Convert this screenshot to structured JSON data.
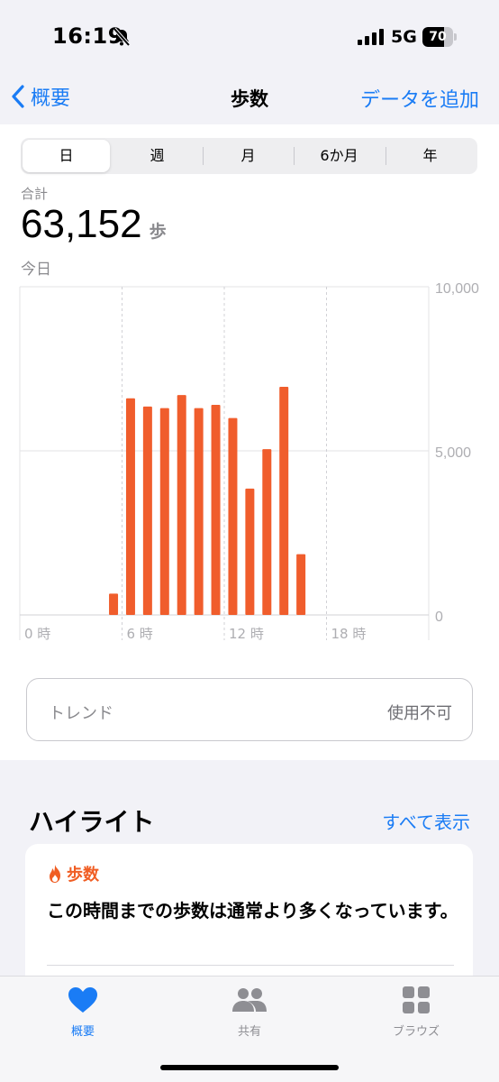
{
  "status_bar": {
    "time": "16:19",
    "network": "5G",
    "battery_level": "70",
    "battery_fraction": 0.7
  },
  "nav": {
    "back_label": "概要",
    "title": "歩数",
    "add_label": "データを追加"
  },
  "segments": [
    {
      "label": "日",
      "selected": true
    },
    {
      "label": "週",
      "selected": false
    },
    {
      "label": "月",
      "selected": false
    },
    {
      "label": "6か月",
      "selected": false
    },
    {
      "label": "年",
      "selected": false
    }
  ],
  "summary": {
    "total_label": "合計",
    "total_value": "63,152",
    "unit": "歩",
    "date_label": "今日"
  },
  "chart_data": {
    "type": "bar",
    "x_label_suffix": "時",
    "x_tick_labels": [
      "0 時",
      "6 時",
      "12 時",
      "18 時"
    ],
    "x_ticks": [
      0,
      6,
      12,
      18
    ],
    "y_tick_labels": [
      "10,000",
      "5,000",
      "0"
    ],
    "y_ticks": [
      10000,
      5000,
      0
    ],
    "ylim": [
      0,
      10000
    ],
    "xlim": [
      0,
      24
    ],
    "bar_color": "#f05d2c",
    "categories": [
      0,
      1,
      2,
      3,
      4,
      5,
      6,
      7,
      8,
      9,
      10,
      11,
      12,
      13,
      14,
      15,
      16,
      17,
      18,
      19,
      20,
      21,
      22,
      23
    ],
    "values": [
      0,
      0,
      0,
      0,
      0,
      650,
      6600,
      6350,
      6300,
      6700,
      6300,
      6400,
      6000,
      3850,
      5050,
      6950,
      1850,
      0,
      0,
      0,
      0,
      0,
      0,
      0
    ],
    "grid": true
  },
  "trend": {
    "label": "トレンド",
    "value": "使用不可"
  },
  "highlights": {
    "title": "ハイライト",
    "show_all": "すべて表示",
    "card": {
      "category": "歩数",
      "icon": "flame-icon",
      "text": "この時間までの歩数は通常より多くなっています。"
    }
  },
  "tabbar": {
    "items": [
      {
        "label": "概要",
        "icon": "heart-icon",
        "active": true
      },
      {
        "label": "共有",
        "icon": "people-icon",
        "active": false
      },
      {
        "label": "ブラウズ",
        "icon": "grid-icon",
        "active": false
      }
    ]
  },
  "colors": {
    "accent": "#1a7cf5",
    "bar": "#f05d2c",
    "highlight": "#f05d23"
  }
}
